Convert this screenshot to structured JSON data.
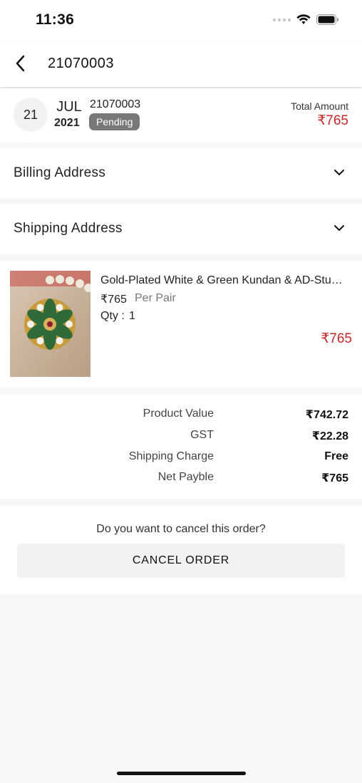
{
  "status_bar": {
    "time": "11:36"
  },
  "nav": {
    "title": "21070003"
  },
  "order": {
    "day": "21",
    "month": "JUL",
    "year": "2021",
    "order_no": "21070003",
    "status": "Pending",
    "total_label": "Total Amount",
    "total_value": "₹765"
  },
  "sections": {
    "billing": "Billing Address",
    "shipping": "Shipping Address"
  },
  "product": {
    "name": "Gold-Plated White & Green Kundan & AD-Studded Ring",
    "price": "₹765",
    "unit": "Per Pair",
    "qty_label": "Qty :",
    "qty": "1",
    "total": "₹765"
  },
  "summary": [
    {
      "label": "Product Value",
      "value": "₹742.72"
    },
    {
      "label": "GST",
      "value": "₹22.28"
    },
    {
      "label": "Shipping Charge",
      "value": "Free"
    },
    {
      "label": "Net Payble",
      "value": "₹765"
    }
  ],
  "cancel": {
    "question": "Do you want to cancel this order?",
    "button": "CANCEL ORDER"
  },
  "colors": {
    "accent_red": "#c62828",
    "badge_gray": "#787878"
  }
}
